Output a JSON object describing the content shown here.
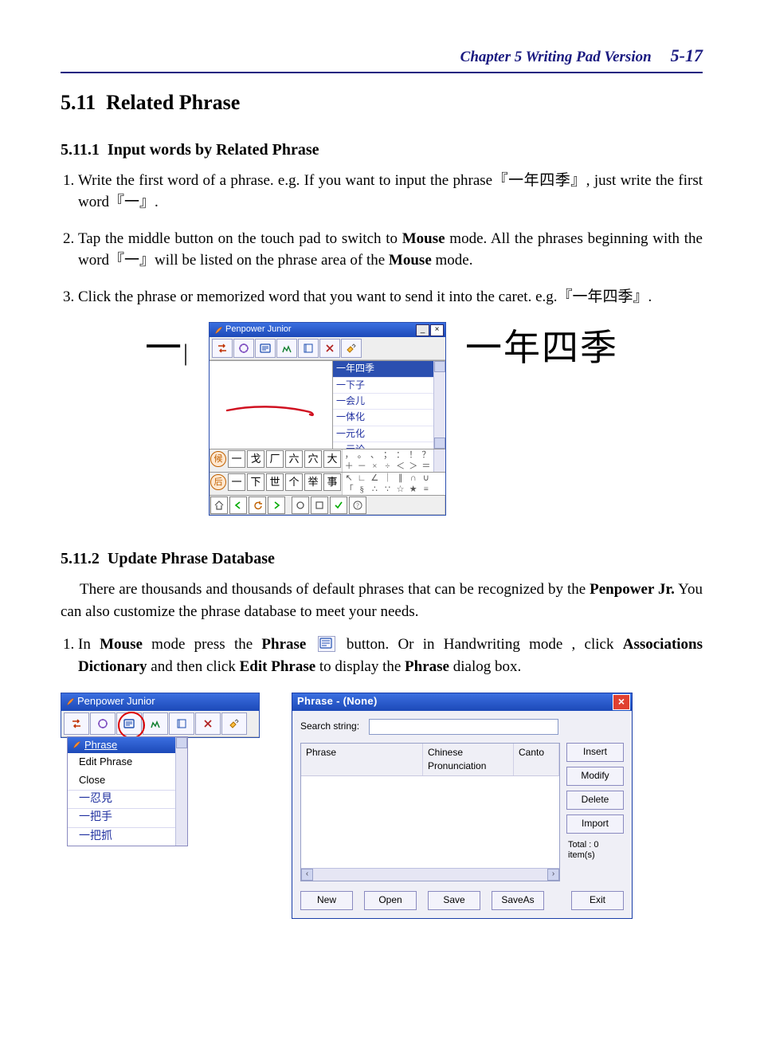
{
  "header": {
    "chapter_label": "Chapter 5 Writing Pad Version",
    "page_number": "5-17"
  },
  "section": {
    "number": "5.11",
    "title": "Related Phrase"
  },
  "sub1": {
    "number": "5.11.1",
    "title": "Input words by Related Phrase",
    "step1_a": "Write the first word of a phrase. e.g. If you want to input the phrase『一年四季』, just write the first word『一』.",
    "step2_a": "Tap the middle button on the touch pad to switch to ",
    "step2_b": "Mouse",
    "step2_c": " mode. All the phrases beginning with the word『一』will be listed on the phrase area of the ",
    "step2_d": "Mouse",
    "step2_e": " mode.",
    "step3_a": "Click the phrase or memorized word that you want to send it into the caret. e.g.『一年四季』."
  },
  "fig1": {
    "before_char": "一",
    "after_phrase": "一年四季",
    "win_title": "Penpower Junior",
    "phrases": [
      "一年四季",
      "一下子",
      "一会儿",
      "一体化",
      "一元化",
      "一元论"
    ],
    "cand_row1_lead": "候",
    "cand_row1": [
      "一",
      "戈",
      "厂",
      "六",
      "穴",
      "大"
    ],
    "cand_row2_lead": "后",
    "cand_row2": [
      "一",
      "下",
      "世",
      "个",
      "举",
      "事"
    ],
    "sym_rows": [
      [
        "，",
        "。",
        "、",
        "；",
        "：",
        "！",
        "？",
        ""
      ],
      [
        "＋",
        "－",
        "×",
        "÷",
        "＜",
        "＞",
        "＝",
        ""
      ],
      [
        "↖",
        "∟",
        "∠",
        "｜",
        "∥",
        "∩",
        "∪",
        ""
      ],
      [
        "「",
        "§",
        "∴",
        "∵",
        "☆",
        "★",
        "≡",
        ""
      ]
    ]
  },
  "sub2": {
    "number": "5.11.2",
    "title": "Update Phrase Database",
    "para_a": "There are thousands and thousands of default phrases that can be recognized by the ",
    "para_b": "Penpower Jr.",
    "para_c": " You can also customize the phrase database to meet your needs.",
    "step1_a": "In ",
    "step1_b": "Mouse",
    "step1_c": " mode press the ",
    "step1_d": "Phrase",
    "step1_e": " button. Or in Handwriting mode , click ",
    "step1_f": "Associations Dictionary",
    "step1_g": " and then click ",
    "step1_h": "Edit Phrase",
    "step1_i": " to display the ",
    "step1_j": "Phrase",
    "step1_k": " dialog box."
  },
  "fig2": {
    "win_title": "Penpower Junior",
    "menu_title": "Phrase",
    "menu_items": [
      "Edit Phrase",
      "Close"
    ],
    "menu_zh": [
      "一忍見",
      "一把手",
      "一把抓"
    ]
  },
  "dlg": {
    "title": "Phrase - (None)",
    "search_label": "Search string:",
    "search_value": "",
    "col_phrase": "Phrase",
    "col_pron": "Chinese Pronunciation",
    "col_canto": "Canto",
    "side": {
      "insert": "Insert",
      "modify": "Modify",
      "delete": "Delete",
      "import": "Import"
    },
    "total_line1": "Total :   0",
    "total_line2": "item(s)",
    "foot": {
      "new": "New",
      "open": "Open",
      "save": "Save",
      "saveas": "SaveAs",
      "exit": "Exit"
    }
  }
}
